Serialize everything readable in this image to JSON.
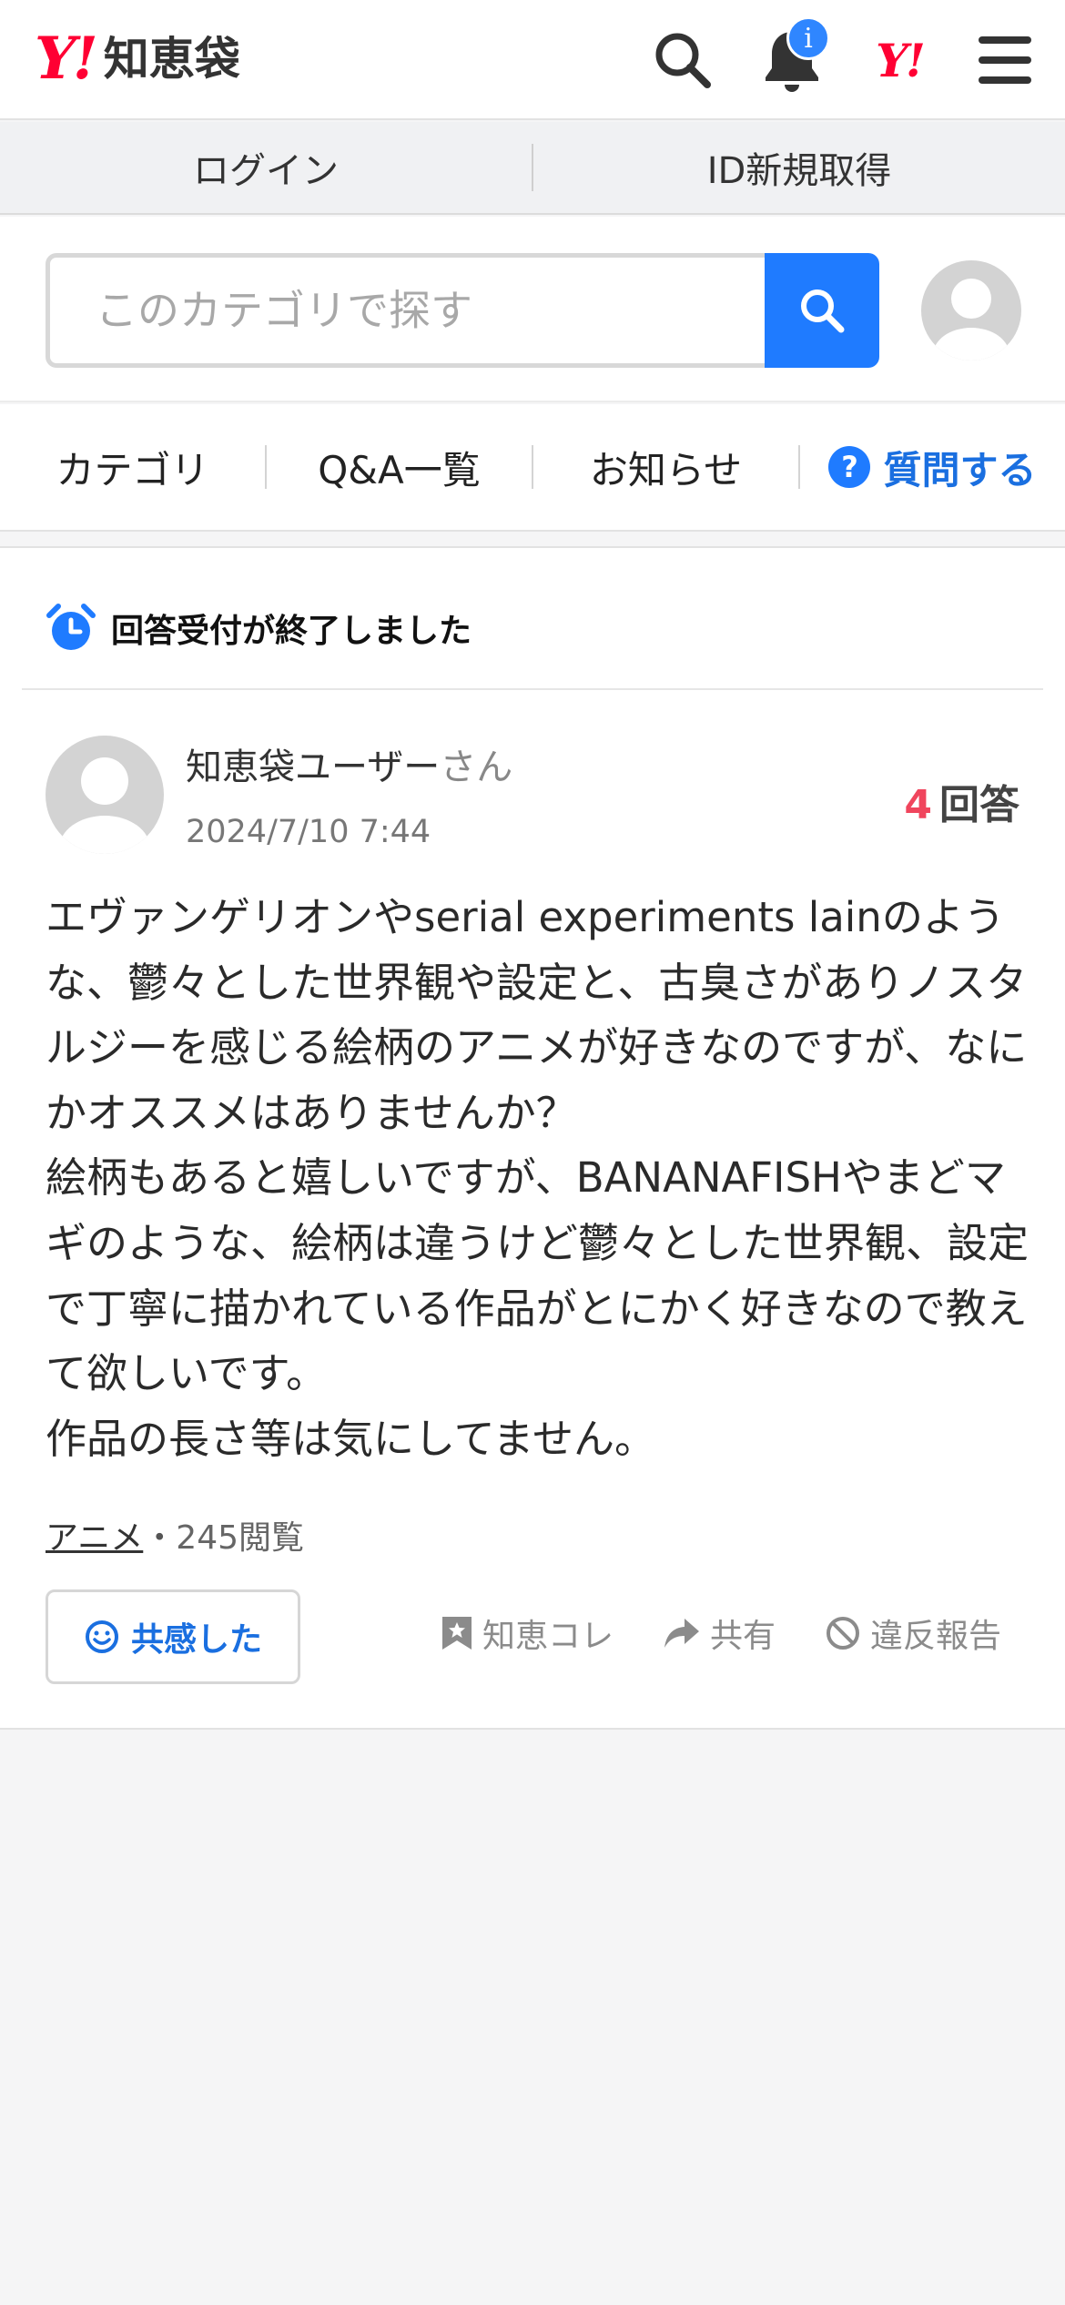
{
  "header": {
    "logo_y": "Y!",
    "logo_name": "知恵袋",
    "notification_badge": "i",
    "yahoo_mark": "Y!"
  },
  "login_bar": {
    "login": "ログイン",
    "register": "ID新規取得"
  },
  "search": {
    "placeholder": "このカテゴリで探す"
  },
  "nav": {
    "category": "カテゴリ",
    "qa_list": "Q&A一覧",
    "news": "お知らせ",
    "ask": "質問する",
    "ask_icon": "?"
  },
  "question": {
    "closed_notice": "回答受付が終了しました",
    "user_name": "知恵袋ユーザー",
    "user_suffix": "さん",
    "date": "2024/7/10 7:44",
    "answer_count": "4",
    "answer_label": "回答",
    "body": "エヴァンゲリオンやserial experiments lainのような、鬱々とした世界観や設定と、古臭さがありノスタルジーを感じる絵柄のアニメが好きなのですが、なにかオススメはありませんか？\n絵柄もあると嬉しいですが、BANANAFISHやまどマギのような、絵柄は違うけど鬱々とした世界観、設定で丁寧に描かれている作品がとにかく好きなので教えて欲しいです。\n作品の長さ等は気にしてません。",
    "category": "アニメ",
    "separator": "・",
    "views": "245閲覧",
    "empathy_button": "共感した",
    "action_save": "知恵コレ",
    "action_share": "共有",
    "action_report": "違反報告"
  },
  "colors": {
    "brand_red": "#ff0033",
    "accent_blue": "#1f7bff",
    "answer_count_red": "#f0455d"
  },
  "icons": [
    "search-icon",
    "bell-icon",
    "menu-icon",
    "avatar-icon",
    "alarm-clock-icon",
    "smile-icon",
    "bookmark-star-icon",
    "share-arrow-icon",
    "prohibited-icon"
  ]
}
